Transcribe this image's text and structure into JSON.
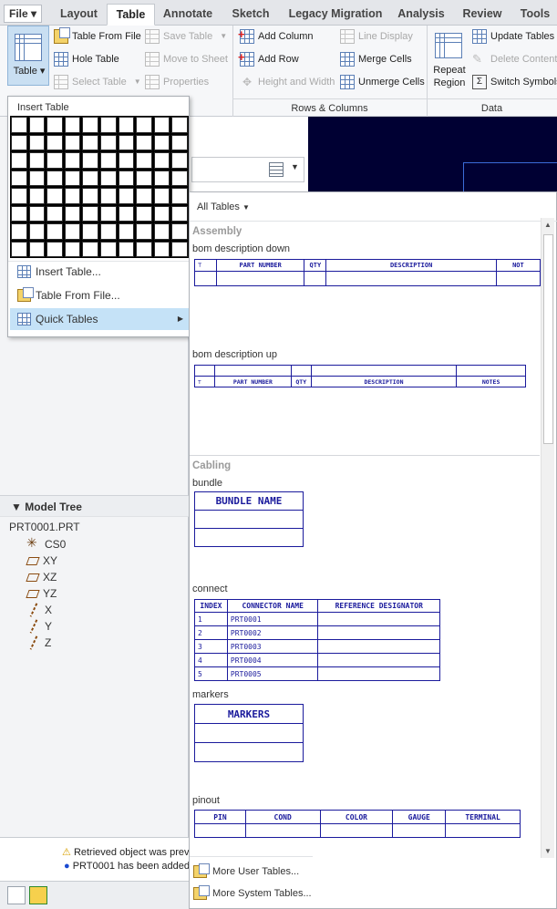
{
  "tabs": {
    "file": "File ▾",
    "items": [
      "Layout",
      "Table",
      "Annotate",
      "Sketch",
      "Legacy Migration",
      "Analysis",
      "Review",
      "Tools"
    ]
  },
  "ribbon": {
    "table_btn": "Table",
    "col1": [
      "Table From File",
      "Hole Table",
      "Select Table"
    ],
    "col2": [
      "Save Table",
      "Move to Sheet",
      "Properties"
    ],
    "col3": [
      "Add Column",
      "Add Row",
      "Height and Width"
    ],
    "col4": [
      "Line Display",
      "Merge Cells",
      "Unmerge Cells"
    ],
    "repeat_region": [
      "Repeat",
      "Region"
    ],
    "col5": [
      "Update Tables",
      "Delete Contents",
      "Switch Symbols"
    ],
    "groups": [
      "Rows & Columns",
      "Data"
    ]
  },
  "menu": {
    "title": "Insert Table",
    "items": [
      "Insert Table...",
      "Table From File...",
      "Quick Tables"
    ]
  },
  "flyout": {
    "filter": "All Tables",
    "categories": [
      "Assembly",
      "Cabling"
    ],
    "tables": {
      "bom_down": {
        "name": "bom description down",
        "headers": [
          "PART NUMBER",
          "QTY",
          "DESCRIPTION",
          "NOT"
        ]
      },
      "bom_up": {
        "name": "bom description up",
        "headers": [
          "PART NUMBER",
          "QTY",
          "DESCRIPTION",
          "NOTES"
        ]
      },
      "bundle": {
        "name": "bundle",
        "header": "BUNDLE NAME"
      },
      "connect": {
        "name": "connect",
        "headers": [
          "INDEX",
          "CONNECTOR NAME",
          "REFERENCE DESIGNATOR"
        ],
        "rows": [
          [
            "1",
            "PRT0001"
          ],
          [
            "2",
            "PRT0002"
          ],
          [
            "3",
            "PRT0003"
          ],
          [
            "4",
            "PRT0004"
          ],
          [
            "5",
            "PRT0005"
          ]
        ]
      },
      "markers": {
        "name": "markers",
        "header": "MARKERS"
      },
      "pinout": {
        "name": "pinout",
        "headers": [
          "PIN",
          "COND",
          "COLOR",
          "GAUGE",
          "TERMINAL"
        ]
      }
    },
    "footer": [
      "More User Tables...",
      "More System Tables..."
    ]
  },
  "model_tree": {
    "title": "Model Tree",
    "root": "PRT0001.PRT",
    "items": [
      "CS0",
      "XY",
      "XZ",
      "YZ",
      "X",
      "Y",
      "Z"
    ]
  },
  "messages": [
    "Retrieved object was prev",
    "PRT0001 has been added"
  ]
}
